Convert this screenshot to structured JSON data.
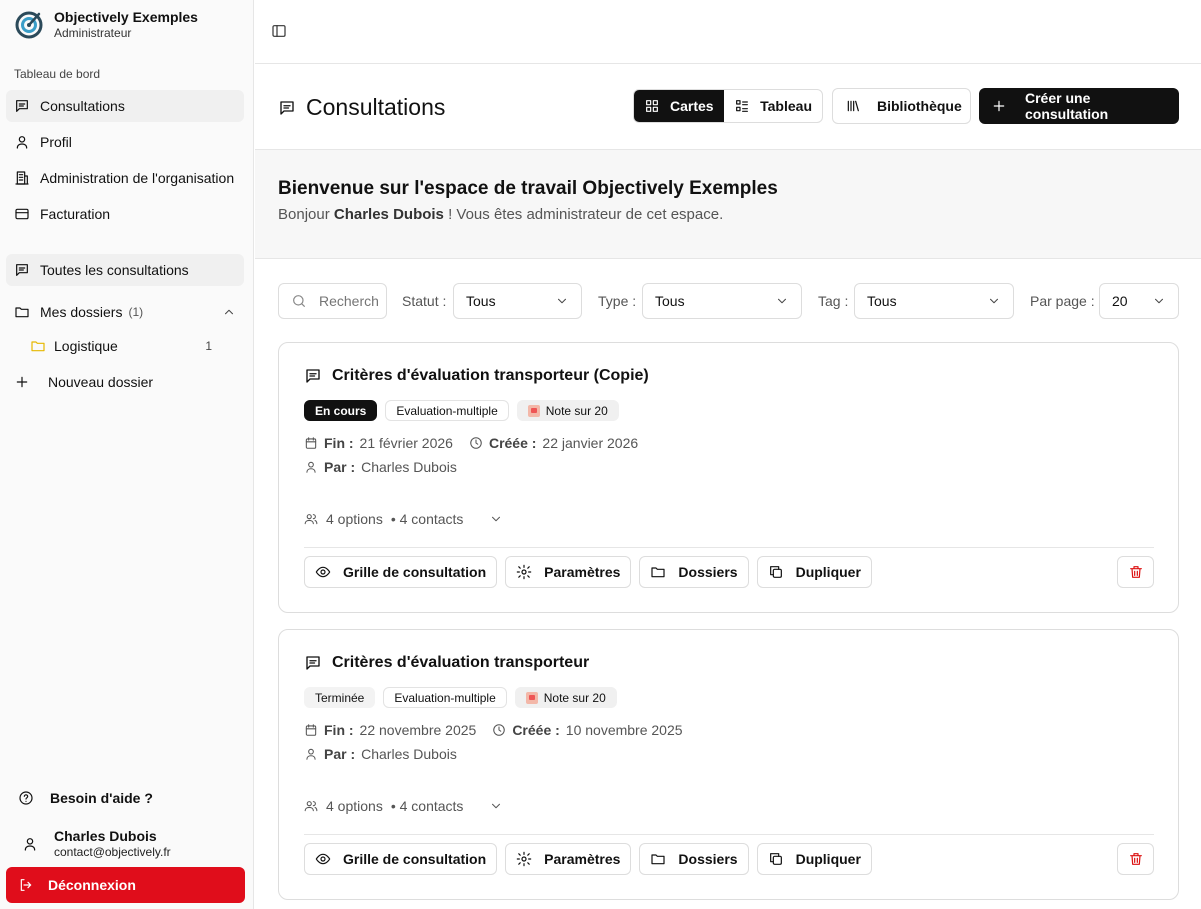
{
  "sidebar": {
    "org_name": "Objectively Exemples",
    "org_role": "Administrateur",
    "section": "Tableau de bord",
    "items": [
      {
        "label": "Consultations"
      },
      {
        "label": "Profil"
      },
      {
        "label": "Administration de l'organisation"
      },
      {
        "label": "Facturation"
      }
    ],
    "all_consultations": "Toutes les consultations",
    "folders": {
      "label": "Mes dossiers",
      "count": "(1)"
    },
    "subfolders": [
      {
        "label": "Logistique",
        "count": "1"
      }
    ],
    "new_folder": "Nouveau dossier",
    "help": "Besoin d'aide ?",
    "user": {
      "name": "Charles Dubois",
      "email": "contact@objectively.fr"
    },
    "logout": "Déconnexion"
  },
  "header": {
    "title": "Consultations",
    "view_cards": "Cartes",
    "view_table": "Tableau",
    "library": "Bibliothèque",
    "create": "Créer une consultation"
  },
  "welcome": {
    "title": "Bienvenue sur l'espace de travail Objectively Exemples",
    "greeting": "Bonjour",
    "user": "Charles Dubois",
    "rest": "! Vous êtes administrateur de cet espace."
  },
  "filters": {
    "search_placeholder": "Recherch",
    "status_label": "Statut :",
    "status_value": "Tous",
    "type_label": "Type :",
    "type_value": "Tous",
    "tag_label": "Tag :",
    "tag_value": "Tous",
    "per_page_label": "Par page :",
    "per_page_value": "20"
  },
  "cards": [
    {
      "title": "Critères d'évaluation transporteur (Copie)",
      "status": "En cours",
      "type": "Evaluation-multiple",
      "note": "Note sur 20",
      "end_label": "Fin :",
      "end_date": "21 février 2026",
      "created_label": "Créée :",
      "created_date": "22 janvier 2026",
      "by_label": "Par :",
      "by_name": "Charles Dubois",
      "options": "4 options",
      "contacts": "• 4 contacts"
    },
    {
      "title": "Critères d'évaluation transporteur",
      "status": "Terminée",
      "type": "Evaluation-multiple",
      "note": "Note sur 20",
      "end_label": "Fin :",
      "end_date": "22 novembre 2025",
      "created_label": "Créée :",
      "created_date": "10 novembre 2025",
      "by_label": "Par :",
      "by_name": "Charles Dubois",
      "options": "4 options",
      "contacts": "• 4 contacts"
    }
  ],
  "card_actions": {
    "grid": "Grille de consultation",
    "settings": "Paramètres",
    "folders": "Dossiers",
    "duplicate": "Dupliquer"
  },
  "colors": {
    "accent": "#111111",
    "danger": "#e00d1b",
    "folder": "#e6b800"
  }
}
